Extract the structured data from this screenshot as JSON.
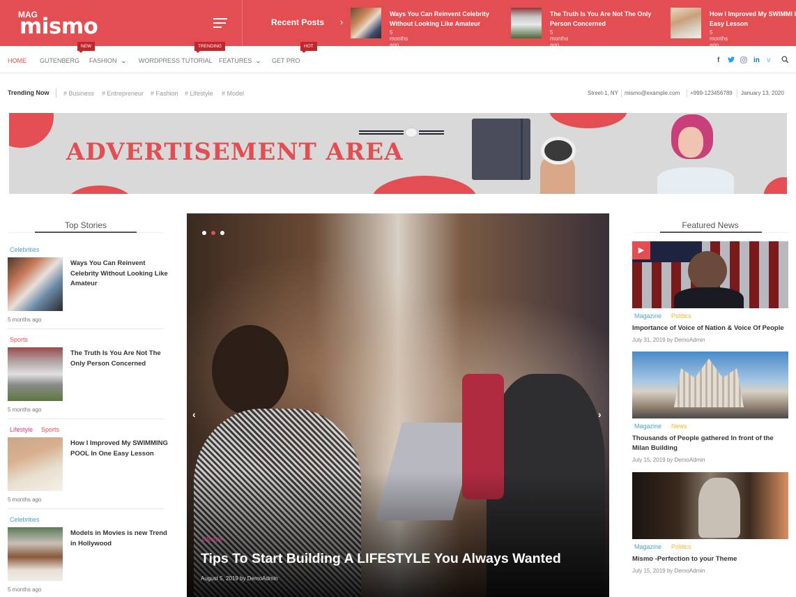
{
  "brand": {
    "small": "MAG",
    "name": "mismo",
    "accent": "#e24e52"
  },
  "recent_posts": {
    "label": "Recent Posts",
    "arrow": "›",
    "items": [
      {
        "title": "Ways You Can Reinvent Celebrity Without Looking Like Amateur",
        "time": "5 months ago"
      },
      {
        "title": "The Truth Is You Are Not The Only Person Concerned",
        "time": "5 months ago"
      },
      {
        "title": "How I Improved My SWIMMI In One Easy Lesson",
        "time": "5 months ago"
      }
    ]
  },
  "nav": {
    "items": [
      {
        "label": "HOME",
        "active": true
      },
      {
        "label": "GUTENBERG"
      },
      {
        "label": "FASHION",
        "badge": "NEW",
        "dropdown": true
      },
      {
        "label": "WORDPRESS TUTORIAL"
      },
      {
        "label": "FEATURES",
        "badge": "TRENDING",
        "dropdown": true
      },
      {
        "label": "GET PRO",
        "badge": "HOT"
      }
    ],
    "chevron": "⌄",
    "social": [
      {
        "name": "facebook",
        "glyph": "f"
      },
      {
        "name": "twitter",
        "glyph": "🐦"
      },
      {
        "name": "instagram",
        "glyph": "◎"
      },
      {
        "name": "linkedin",
        "glyph": "in"
      },
      {
        "name": "vimeo",
        "glyph": "v"
      },
      {
        "name": "search",
        "glyph": "⚲"
      }
    ]
  },
  "trending": {
    "label": "Trending Now",
    "tags": [
      "# Business",
      "# Entrepreneur",
      "# Fashion",
      "# Lifestyle",
      "# Model"
    ],
    "info": [
      "Street-1, NY",
      "mismo@example.com",
      "+999-123456789",
      "January 13, 2020"
    ]
  },
  "ad": {
    "text": "ADVERTISEMENT AREA"
  },
  "top_stories": {
    "title": "Top Stories",
    "items": [
      {
        "cats": [
          {
            "label": "Celebrities",
            "color": "#4a9fd8"
          }
        ],
        "title": "Ways You Can Reinvent Celebrity Without Looking Like Amateur",
        "time": "5 months ago"
      },
      {
        "cats": [
          {
            "label": "Sports",
            "color": "#e24e52"
          }
        ],
        "title": "The Truth Is You Are Not The Only Person Concerned",
        "time": "5 months ago"
      },
      {
        "cats": [
          {
            "label": "Lifestyle",
            "color": "#e0358a"
          },
          {
            "label": "Sports",
            "color": "#e24e52"
          }
        ],
        "title": "How I Improved My SWIMMING POOL In One Easy Lesson",
        "time": "5 months ago"
      },
      {
        "cats": [
          {
            "label": "Celebrities",
            "color": "#4a9fd8"
          }
        ],
        "title": "Models in Movies is new Trend in Hollywood",
        "time": "5 months ago"
      }
    ]
  },
  "slider": {
    "dots": 3,
    "active_dot": 2,
    "prev": "‹",
    "next": "›",
    "category": "Lifestyle",
    "title": "Tips To Start Building A LIFESTYLE You Always Wanted",
    "meta": "August 5, 2019 by DemoAdmin"
  },
  "featured": {
    "title": "Featured News",
    "items": [
      {
        "cats": [
          {
            "label": "Magazine",
            "color": "#4a9fd8"
          },
          {
            "label": "Politics",
            "color": "#f0b731"
          }
        ],
        "title": "Importance of Voice of Nation & Voice Of People",
        "meta": "July 31, 2019 by DemoAdmin",
        "video_badge": "▶"
      },
      {
        "cats": [
          {
            "label": "Magazine",
            "color": "#4a9fd8"
          },
          {
            "label": "News",
            "color": "#f0b731"
          }
        ],
        "title": "Thousands of People gathered In front of the Milan Building",
        "meta": "July 15, 2019 by DemoAdmin"
      },
      {
        "cats": [
          {
            "label": "Magazine",
            "color": "#4a9fd8"
          },
          {
            "label": "Politics",
            "color": "#f0b731"
          }
        ],
        "title": "Mismo -Perfection to your Theme",
        "meta": "July 15, 2019 by DemoAdmin"
      }
    ]
  }
}
